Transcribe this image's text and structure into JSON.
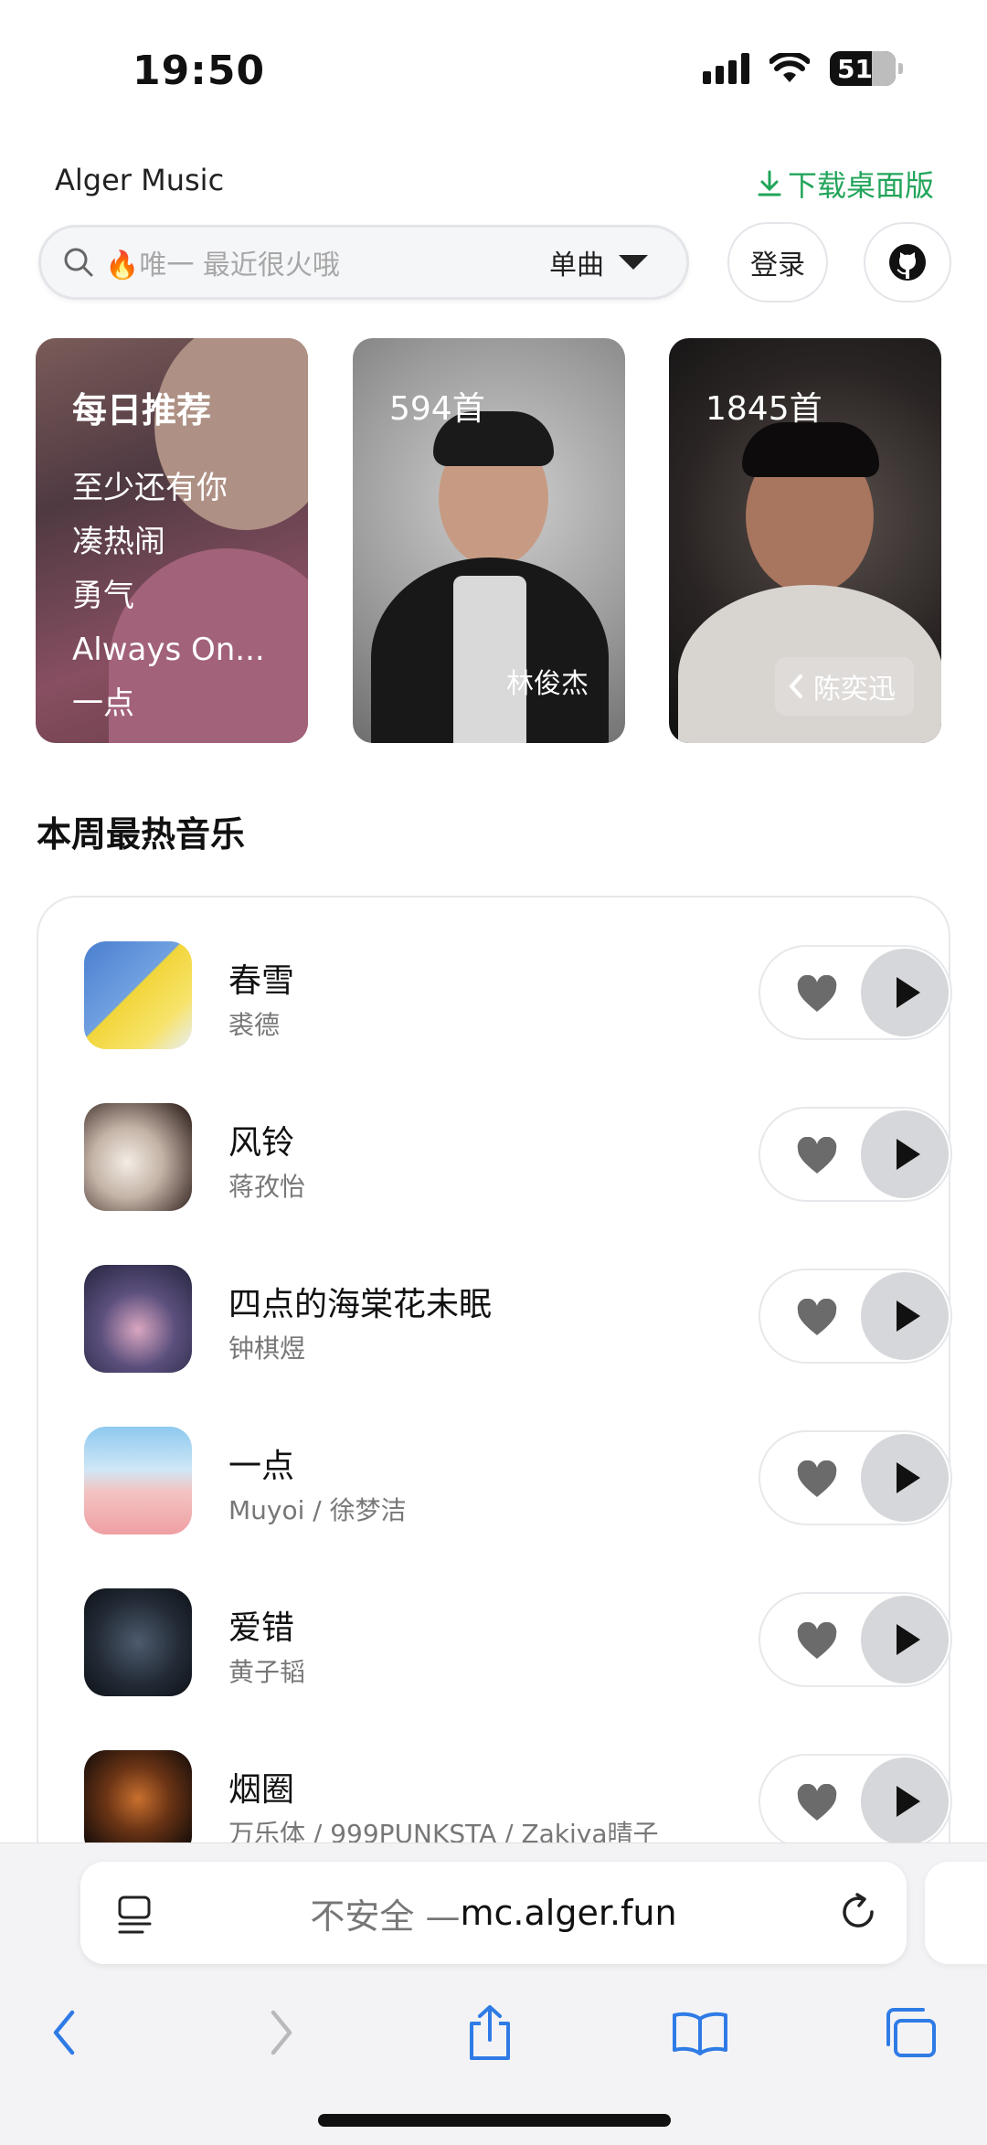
{
  "status_bar": {
    "time": "19:50",
    "battery": "51"
  },
  "header": {
    "app_title": "Alger Music",
    "download_label": "下载桌面版"
  },
  "search": {
    "placeholder": "🔥唯一 最近很火哦",
    "type": "单曲",
    "login_label": "登录"
  },
  "cards": {
    "daily": {
      "title": "每日推荐",
      "songs": [
        "至少还有你",
        "凑热闹",
        "勇气",
        "Always On...",
        "一点"
      ]
    },
    "artist1": {
      "count": "594首",
      "name": "林俊杰"
    },
    "artist2": {
      "count": "1845首",
      "name": "陈奕迅"
    }
  },
  "section": {
    "title": "本周最热音乐"
  },
  "songs": [
    {
      "name": "春雪",
      "artist": "裘德"
    },
    {
      "name": "风铃",
      "artist": "蒋孜怡"
    },
    {
      "name": "四点的海棠花未眠",
      "artist": "钟棋煜"
    },
    {
      "name": "一点",
      "artist": "Muyoi / 徐梦洁"
    },
    {
      "name": "爱错",
      "artist": "黄子韬"
    },
    {
      "name": "烟圈",
      "artist": "万乐体 / 999PUNKSTA / Zakiya晴子"
    }
  ],
  "browser": {
    "security": "不安全 — ",
    "host": "mc.alger.fun"
  },
  "colors": {
    "accent_green": "#22a55a",
    "play_bg": "#d6d7da"
  }
}
